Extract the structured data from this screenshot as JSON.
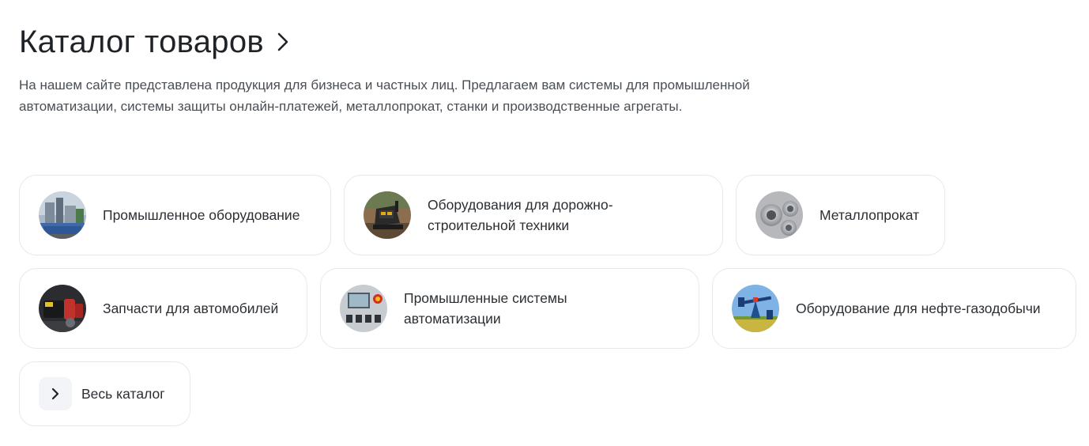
{
  "header": {
    "title": "Каталог товаров",
    "description": "На нашем сайте представлена продукция для бизнеса и частных лиц. Предлагаем вам системы для промышленной автоматизации, системы защиты онлайн-платежей, металлопрокат, станки и производственные агрегаты."
  },
  "categories": [
    {
      "label": "Промышленное оборудование",
      "icon": "industrial-plant-photo"
    },
    {
      "label": "Оборудования для дорожно-строительной техники",
      "icon": "road-paver-photo"
    },
    {
      "label": "Металлопрокат",
      "icon": "metal-pipes-photo"
    },
    {
      "label": "Запчасти для автомобилей",
      "icon": "car-parts-photo"
    },
    {
      "label": "Промышленные системы автоматизации",
      "icon": "control-panel-photo"
    },
    {
      "label": "Оборудование для нефте-газодобычи",
      "icon": "oil-pump-jack-photo"
    }
  ],
  "all_catalog": {
    "label": "Весь каталог",
    "icon": "chevron-right-icon"
  },
  "colors": {
    "text": "#1f2328",
    "muted": "#4a4f55",
    "border": "#e6e8eb",
    "icon_bg": "#f2f4f7"
  }
}
